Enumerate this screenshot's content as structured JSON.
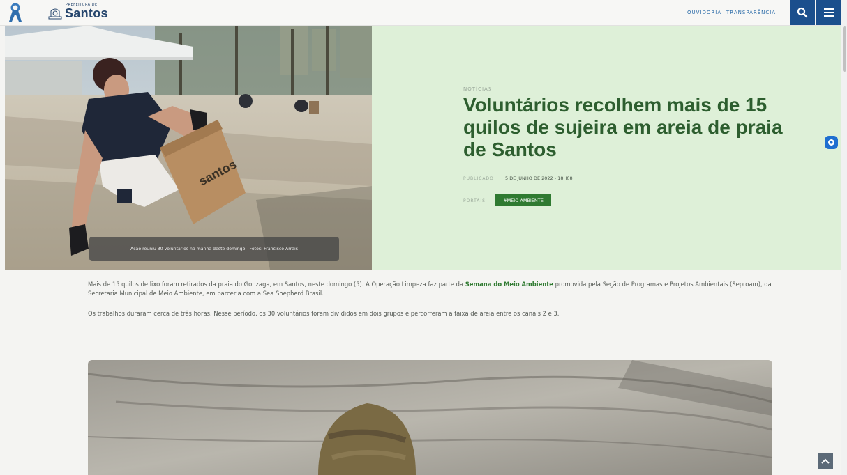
{
  "header": {
    "logo_small": "PREFEITURA DE",
    "logo_big": "Santos",
    "nav": [
      "OUVIDORIA",
      "TRANSPARÊNCIA"
    ],
    "search_icon": "search-icon",
    "menu_icon": "hamburger-menu-icon"
  },
  "hero": {
    "kicker": "NOTÍCIAS",
    "headline": "Voluntários recolhem mais de 15 quilos de sujeira em areia de praia de Santos",
    "published_label": "PUBLICADO",
    "published_date": "5 DE JUNHO DE 2022 - 18H08",
    "portais_label": "PORTAIS",
    "tag": "#MEIO AMBIENTE",
    "caption": "Ação reuniu 30 voluntários na manhã deste domingo - Fotos: Francisco Arrais",
    "box_print": "santos"
  },
  "article": {
    "p1_before": "Mais de 15 quilos de lixo foram retirados da praia do Gonzaga, em Santos, neste domingo (5).  A Operação Limpeza faz parte da ",
    "p1_link": "Semana do Meio Ambiente",
    "p1_after": " promovida pela Seção de Programas e Projetos Ambientais (Seproam), da Secretaria Municipal de Meio Ambiente, em parceria com a Sea Shepherd Brasil.",
    "p2": "Os trabalhos duraram cerca de três horas. Nesse período, os 30 voluntários foram divididos em dois grupos e percorreram a faixa de areia entre os canais 2 e 3."
  },
  "colors": {
    "brand_blue": "#1b4f8d",
    "headline_green": "#2d5e2f",
    "tag_green": "#2f7a31",
    "panel_green": "#def0d8"
  }
}
